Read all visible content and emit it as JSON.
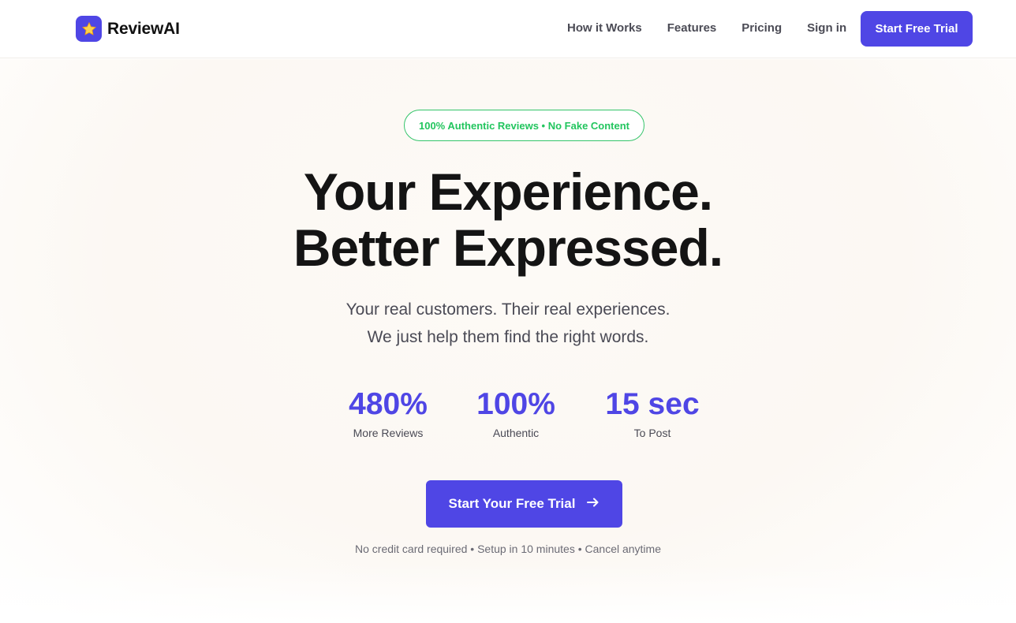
{
  "brand": {
    "name": "ReviewAI",
    "icon": "star-icon",
    "icon_bg": "#4f46e5"
  },
  "nav": {
    "links": [
      "How it Works",
      "Features",
      "Pricing"
    ],
    "sign_in": "Sign in",
    "cta": "Start Free Trial"
  },
  "hero": {
    "badge": "100% Authentic Reviews • No Fake Content",
    "headline_line1": "Your Experience.",
    "headline_line2": "Better Expressed.",
    "subtitle_line1": "Your real customers. Their real experiences.",
    "subtitle_line2": "We just help them find the right words.",
    "stats": [
      {
        "value": "480%",
        "label": "More Reviews"
      },
      {
        "value": "100%",
        "label": "Authentic"
      },
      {
        "value": "15 sec",
        "label": "To Post"
      }
    ],
    "cta": "Start Your Free Trial",
    "cta_icon": "arrow-right-icon",
    "footnote": "No credit card required • Setup in 10 minutes • Cancel anytime"
  },
  "colors": {
    "accent": "#4f46e5",
    "badge_green": "#22c55e",
    "heading": "#141414",
    "text": "#4a4a55"
  }
}
